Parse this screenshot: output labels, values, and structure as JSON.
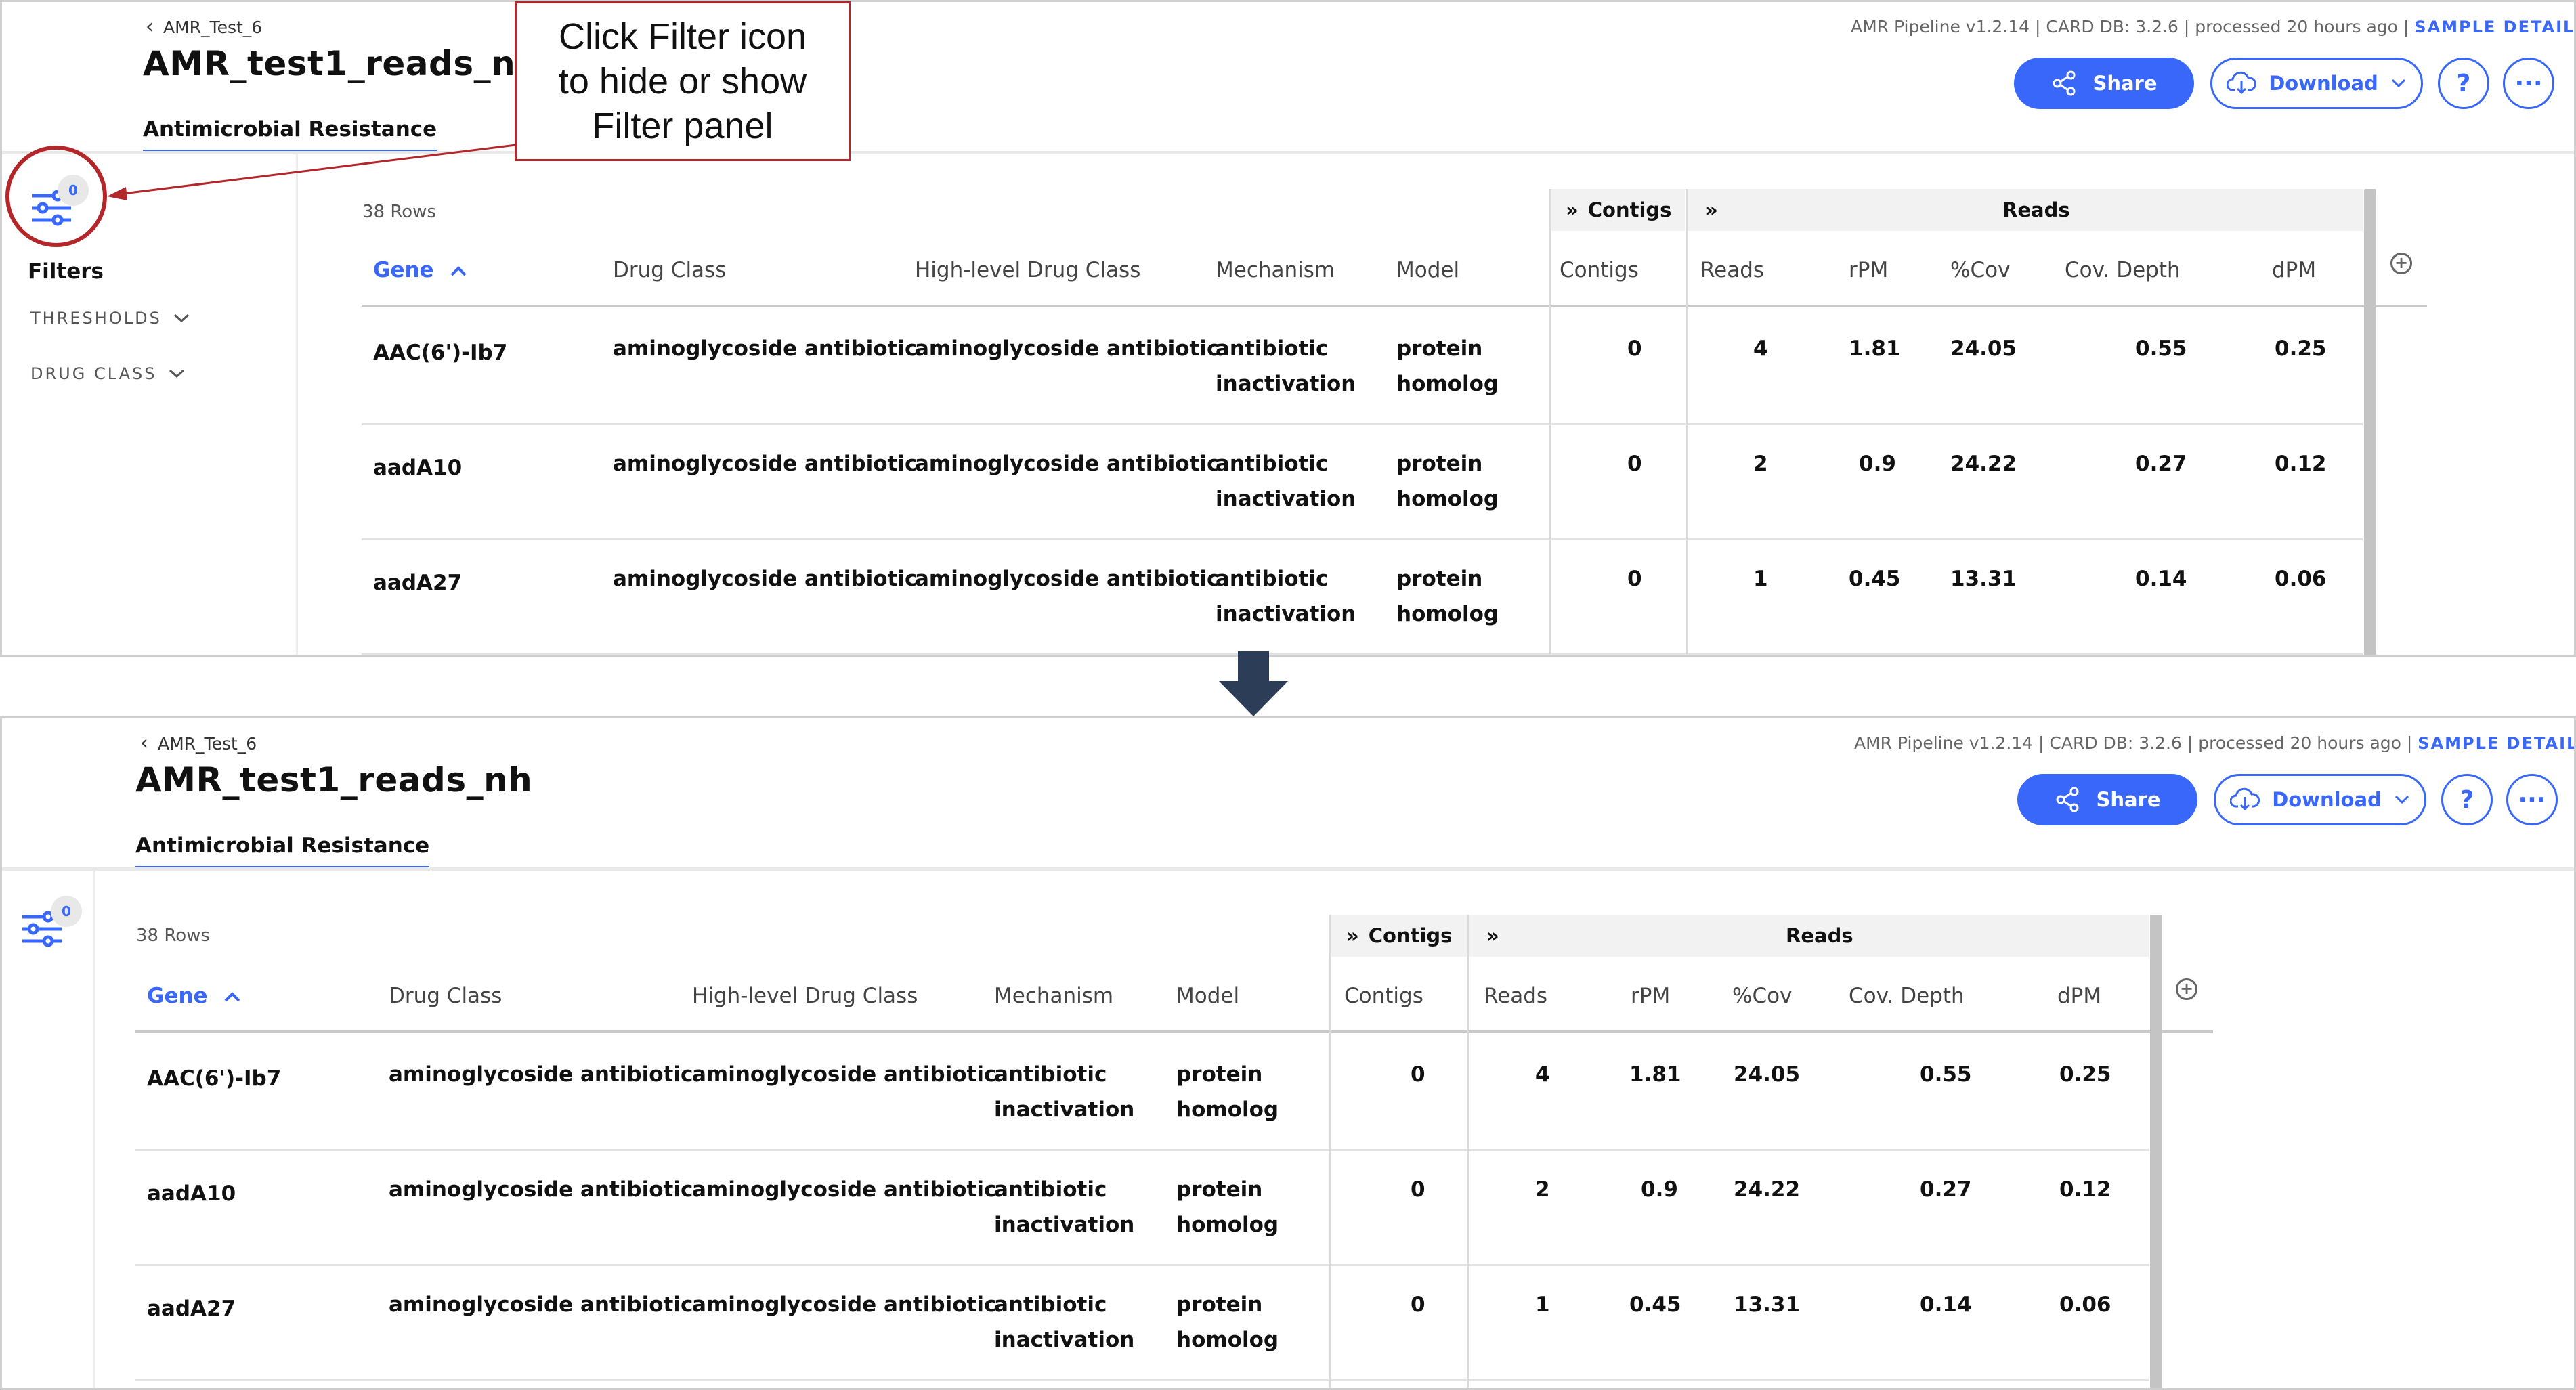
{
  "callout": {
    "line1": "Click Filter icon",
    "line2": "to hide or show",
    "line3": "Filter panel"
  },
  "header": {
    "breadcrumb": "AMR_Test_6",
    "title": "AMR_test1_reads_nh",
    "tab": "Antimicrobial Resistance",
    "meta": "AMR Pipeline v1.2.14 | CARD DB: 3.2.6 | processed 20 hours ago |",
    "sample_details": "SAMPLE DETAILS",
    "share_label": "Share",
    "download_label": "Download",
    "help_label": "?",
    "more_label": "···"
  },
  "filters": {
    "badge": "0",
    "title": "Filters",
    "groups": [
      "THRESHOLDS",
      "DRUG CLASS"
    ]
  },
  "table": {
    "rows_count": "38 Rows",
    "group_contigs": "Contigs",
    "group_reads": "Reads",
    "expand_glyph": "»",
    "columns": [
      "Gene",
      "Drug Class",
      "High-level Drug Class",
      "Mechanism",
      "Model",
      "Contigs",
      "Reads",
      "rPM",
      "%Cov",
      "Cov. Depth",
      "dPM"
    ],
    "rows": [
      {
        "gene": "AAC(6')-Ib7",
        "drug_class": "aminoglycoside antibiotic",
        "high_level": "aminoglycoside antibiotic",
        "mechanism_1": "antibiotic",
        "mechanism_2": "inactivation",
        "model_1": "protein",
        "model_2": "homolog",
        "contigs": "0",
        "reads": "4",
        "rpm": "1.81",
        "cov": "24.05",
        "cov_depth": "0.55",
        "dpm": "0.25"
      },
      {
        "gene": "aadA10",
        "drug_class": "aminoglycoside antibiotic",
        "high_level": "aminoglycoside antibiotic",
        "mechanism_1": "antibiotic",
        "mechanism_2": "inactivation",
        "model_1": "protein",
        "model_2": "homolog",
        "contigs": "0",
        "reads": "2",
        "rpm": "0.9",
        "cov": "24.22",
        "cov_depth": "0.27",
        "dpm": "0.12"
      },
      {
        "gene": "aadA27",
        "drug_class": "aminoglycoside antibiotic",
        "high_level": "aminoglycoside antibiotic",
        "mechanism_1": "antibiotic",
        "mechanism_2": "inactivation",
        "model_1": "protein",
        "model_2": "homolog",
        "contigs": "0",
        "reads": "1",
        "rpm": "0.45",
        "cov": "13.31",
        "cov_depth": "0.14",
        "dpm": "0.06"
      }
    ]
  },
  "colors": {
    "accent": "#3867fa",
    "callout_border": "#b3262a",
    "down_arrow": "#2c3e57"
  },
  "icons": [
    "chevron-left-icon",
    "share-icon",
    "cloud-download-icon",
    "chevron-down-icon",
    "filter-sliders-icon",
    "sort-up-icon",
    "add-column-icon",
    "expand-icon",
    "down-arrow-icon"
  ]
}
